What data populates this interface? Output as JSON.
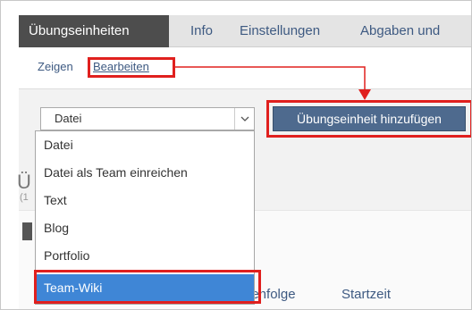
{
  "tabs": [
    {
      "label": "Übungseinheiten",
      "active": true
    },
    {
      "label": "Info",
      "active": false
    },
    {
      "label": "Einstellungen",
      "active": false
    },
    {
      "label": "Abgaben und",
      "active": false
    }
  ],
  "subtabs": [
    {
      "label": "Zeigen"
    },
    {
      "label": "Bearbeiten"
    }
  ],
  "select": {
    "value": "Datei",
    "arrow_icon": "chevron-down-icon"
  },
  "add_button": {
    "label": "Übungseinheit hinzufügen"
  },
  "dropdown": {
    "options": [
      "Datei",
      "Datei als Team einreichen",
      "Text",
      "Blog",
      "Portfolio",
      "Team-Wiki"
    ],
    "selected": "Team-Wiki"
  },
  "background": {
    "heading_fragment": "Ü",
    "count_fragment": "(1",
    "column_reihenfolge": "henfolge",
    "column_startzeit": "Startzeit"
  },
  "colors": {
    "tab_active_bg": "#4d4d4d",
    "link": "#3e5a82",
    "button_bg": "#4e6a8e",
    "selected_option": "#3f86d6",
    "annotation_red": "#e0201e"
  }
}
